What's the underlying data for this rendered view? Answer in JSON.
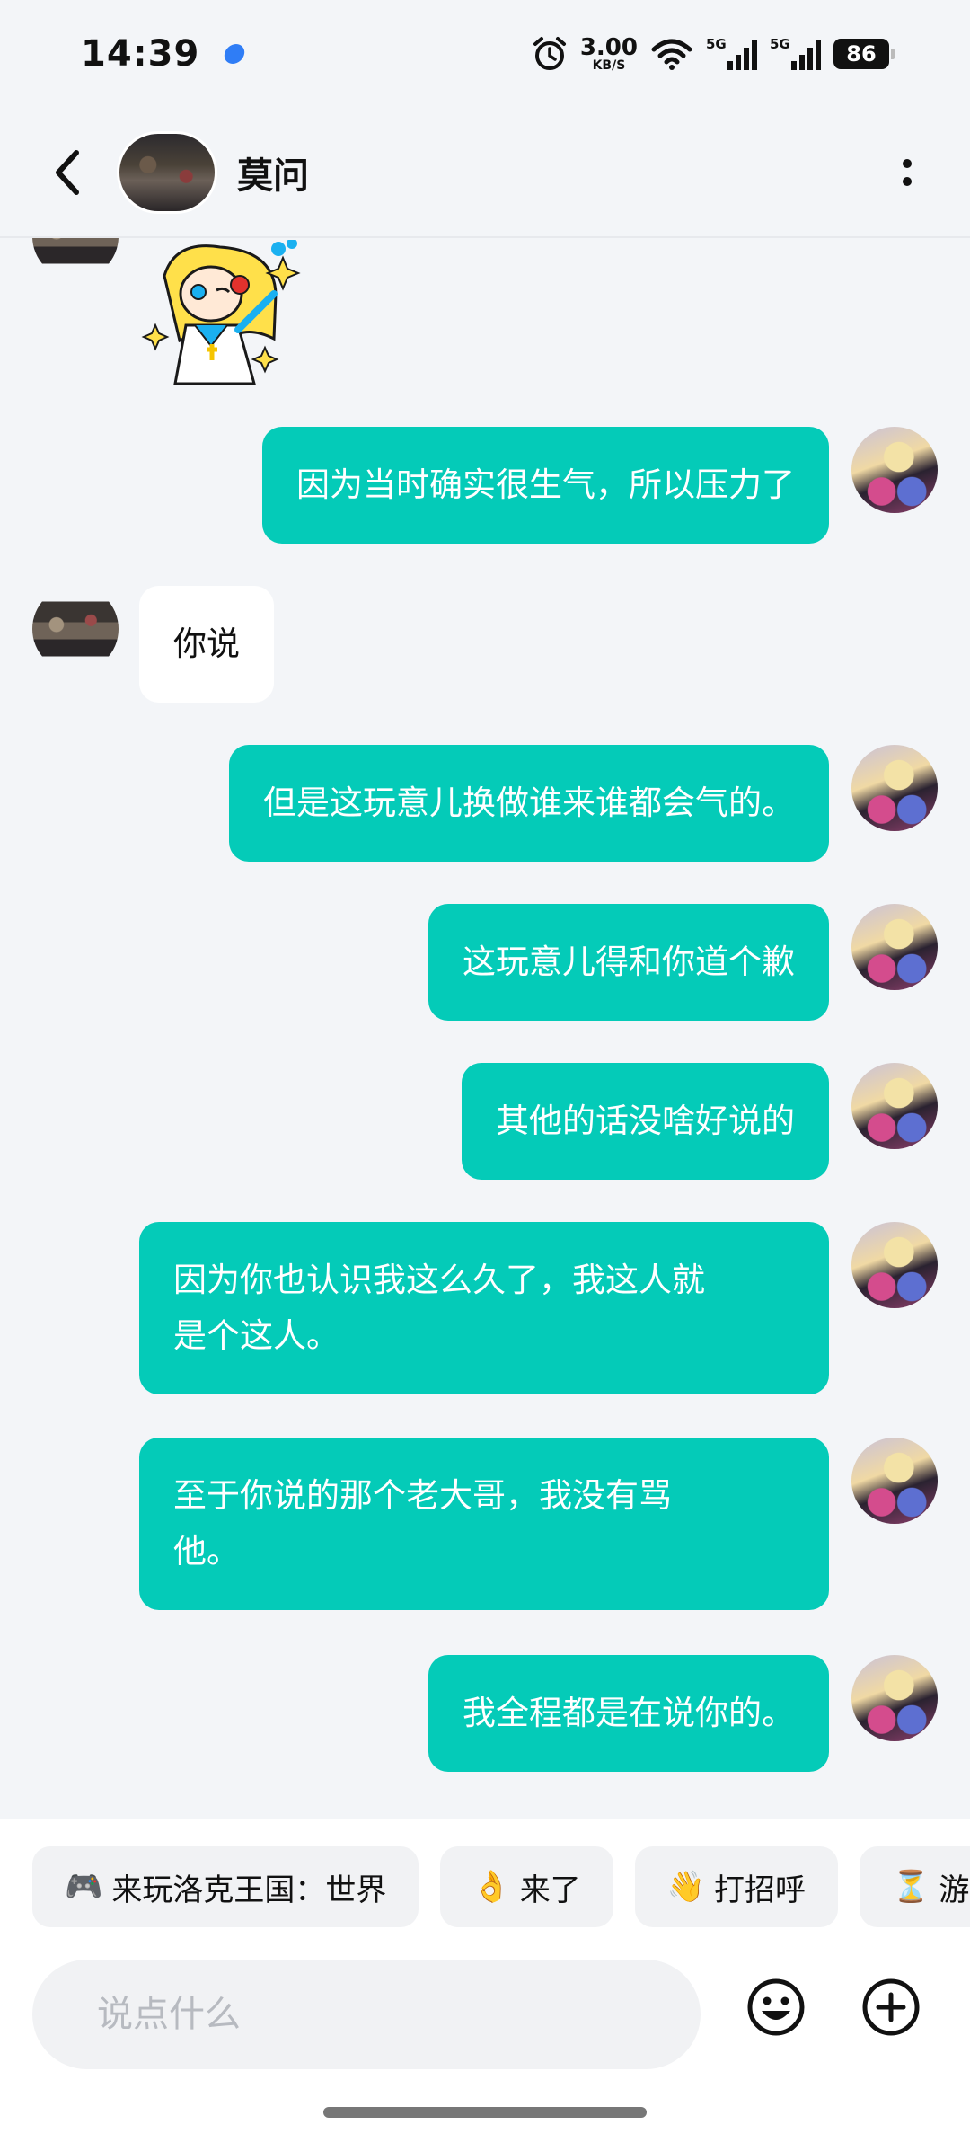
{
  "status": {
    "time": "14:39",
    "net_speed": "3.00",
    "net_unit": "KB/S",
    "sig1_label": "5G",
    "sig2_label": "5G",
    "battery": "86"
  },
  "header": {
    "name": "莫问"
  },
  "messages": [
    {
      "side": "me",
      "text": "因为当时确实很生气，所以压力了"
    },
    {
      "side": "other",
      "text": "你说"
    },
    {
      "side": "me",
      "text": "但是这玩意儿换做谁来谁都会气的。"
    },
    {
      "side": "me",
      "text": "这玩意儿得和你道个歉"
    },
    {
      "side": "me",
      "text": "其他的话没啥好说的"
    },
    {
      "side": "me",
      "line1": "因为你也认识我这么久了，我这人就",
      "line2": "是个这人。"
    },
    {
      "side": "me",
      "line1": "至于你说的那个老大哥，我没有骂",
      "line2": "他。"
    },
    {
      "side": "me",
      "text": "我全程都是在说你的。"
    }
  ],
  "quick_replies": [
    {
      "icon": "🎮",
      "label": "来玩洛克王国：世界"
    },
    {
      "icon": "👌",
      "label": "来了"
    },
    {
      "icon": "👋",
      "label": "打招呼"
    },
    {
      "icon": "⏳",
      "label": "游"
    }
  ],
  "input": {
    "placeholder": "说点什么"
  }
}
